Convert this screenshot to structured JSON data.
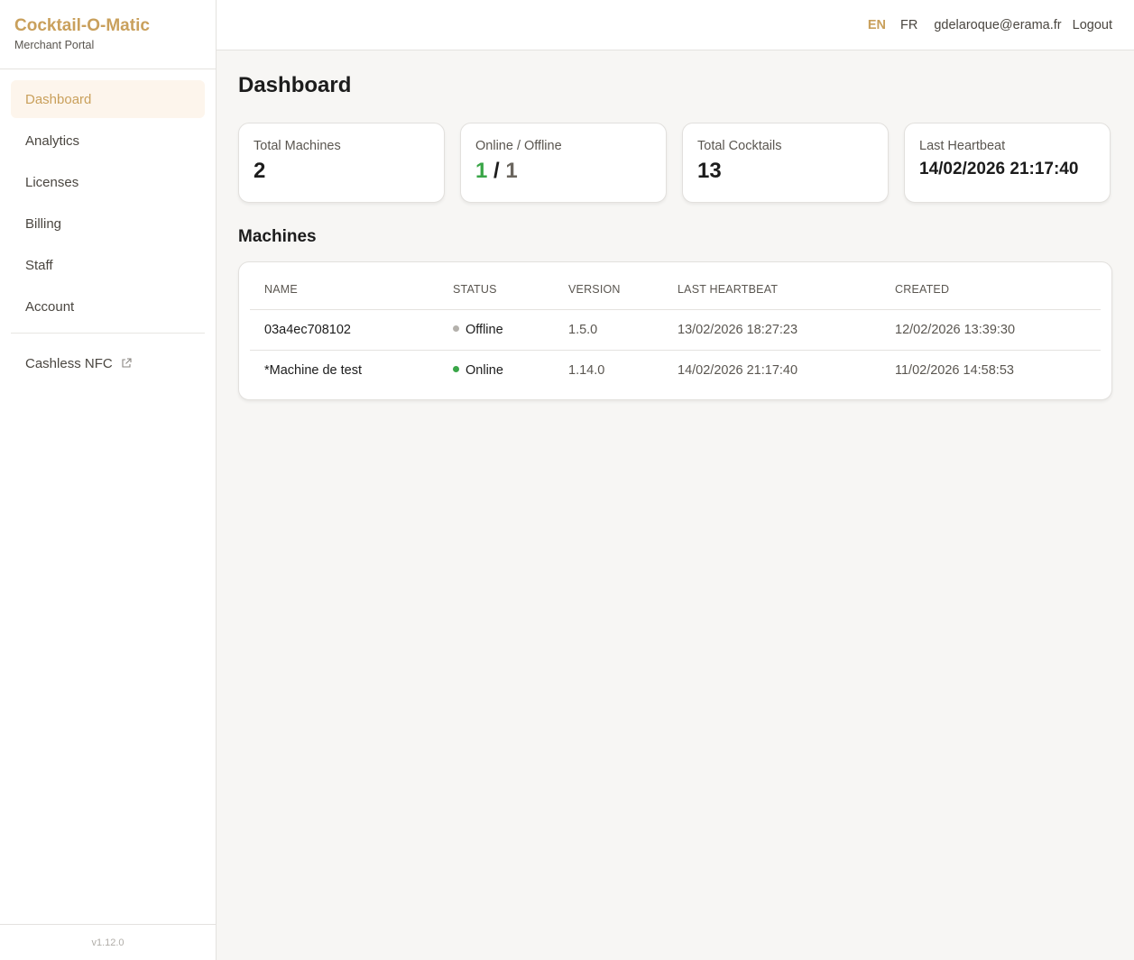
{
  "brand": {
    "title": "Cocktail-O-Matic",
    "subtitle": "Merchant Portal"
  },
  "sidebar": {
    "items": [
      {
        "label": "Dashboard",
        "active": true
      },
      {
        "label": "Analytics",
        "active": false
      },
      {
        "label": "Licenses",
        "active": false
      },
      {
        "label": "Billing",
        "active": false
      },
      {
        "label": "Staff",
        "active": false
      },
      {
        "label": "Account",
        "active": false
      }
    ],
    "external": {
      "label": "Cashless NFC",
      "icon": "external-link-icon"
    },
    "version": "v1.12.0"
  },
  "topbar": {
    "lang_en": "EN",
    "lang_fr": "FR",
    "active_lang": "EN",
    "user_email": "gdelaroque@erama.fr",
    "logout": "Logout"
  },
  "page": {
    "title": "Dashboard"
  },
  "stats": {
    "total_machines": {
      "label": "Total Machines",
      "value": "2"
    },
    "online_offline": {
      "label": "Online / Offline",
      "online": "1",
      "separator": "/",
      "offline": "1"
    },
    "total_cocktails": {
      "label": "Total Cocktails",
      "value": "13"
    },
    "last_heartbeat": {
      "label": "Last Heartbeat",
      "value": "14/02/2026 21:17:40"
    }
  },
  "machines": {
    "title": "Machines",
    "columns": [
      "NAME",
      "STATUS",
      "VERSION",
      "LAST HEARTBEAT",
      "CREATED"
    ],
    "rows": [
      {
        "name": "03a4ec708102",
        "status": "Offline",
        "version": "1.5.0",
        "last_heartbeat": "13/02/2026 18:27:23",
        "created": "12/02/2026 13:39:30"
      },
      {
        "name": "*Machine de test",
        "status": "Online",
        "version": "1.14.0",
        "last_heartbeat": "14/02/2026 21:17:40",
        "created": "11/02/2026 14:58:53"
      }
    ]
  },
  "colors": {
    "accent": "#c9a05c",
    "online": "#3aa648",
    "offline_dot": "#b4b1ac"
  }
}
